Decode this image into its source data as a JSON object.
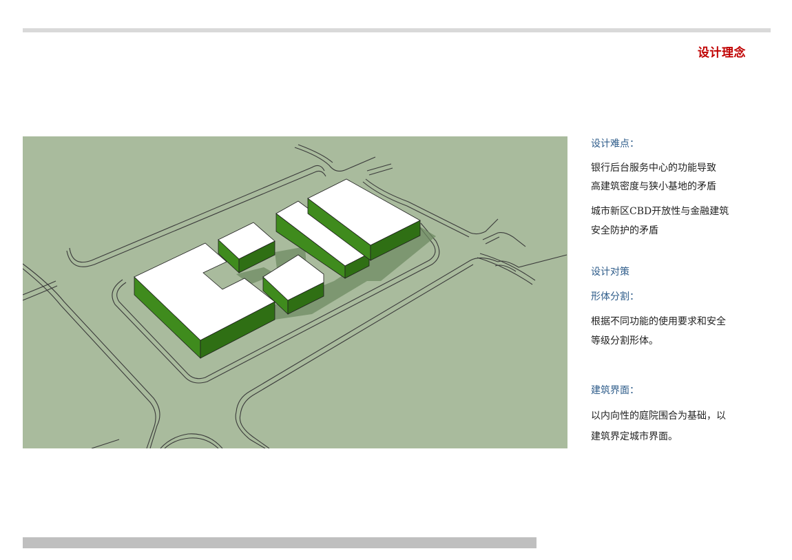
{
  "page": {
    "title": "设计理念",
    "title_color": "#c00000"
  },
  "figure": {
    "ground_color": "#a9bb9d",
    "building_roof_color": "#ffffff",
    "building_wall_color": "#3f8b1d",
    "road_line_color": "#3a3a3a"
  },
  "notes": {
    "difficulty_heading": "设计难点：",
    "difficulty_line_1": "银行后台服务中心的功能导致",
    "difficulty_line_2": "高建筑密度与狭小基地的矛盾",
    "difficulty_line_3": "城市新区CBD开放性与金融建筑",
    "difficulty_line_4": "安全防护的矛盾",
    "strategy_heading": "设计对策",
    "form_heading": "形体分割：",
    "form_line_1": "根据不同功能的使用要求和安全",
    "form_line_2": "等级分割形体。",
    "interface_heading": "建筑界面：",
    "interface_line_1": "以内向性的庭院围合为基础，以",
    "interface_line_2": "建筑界定城市界面。"
  }
}
